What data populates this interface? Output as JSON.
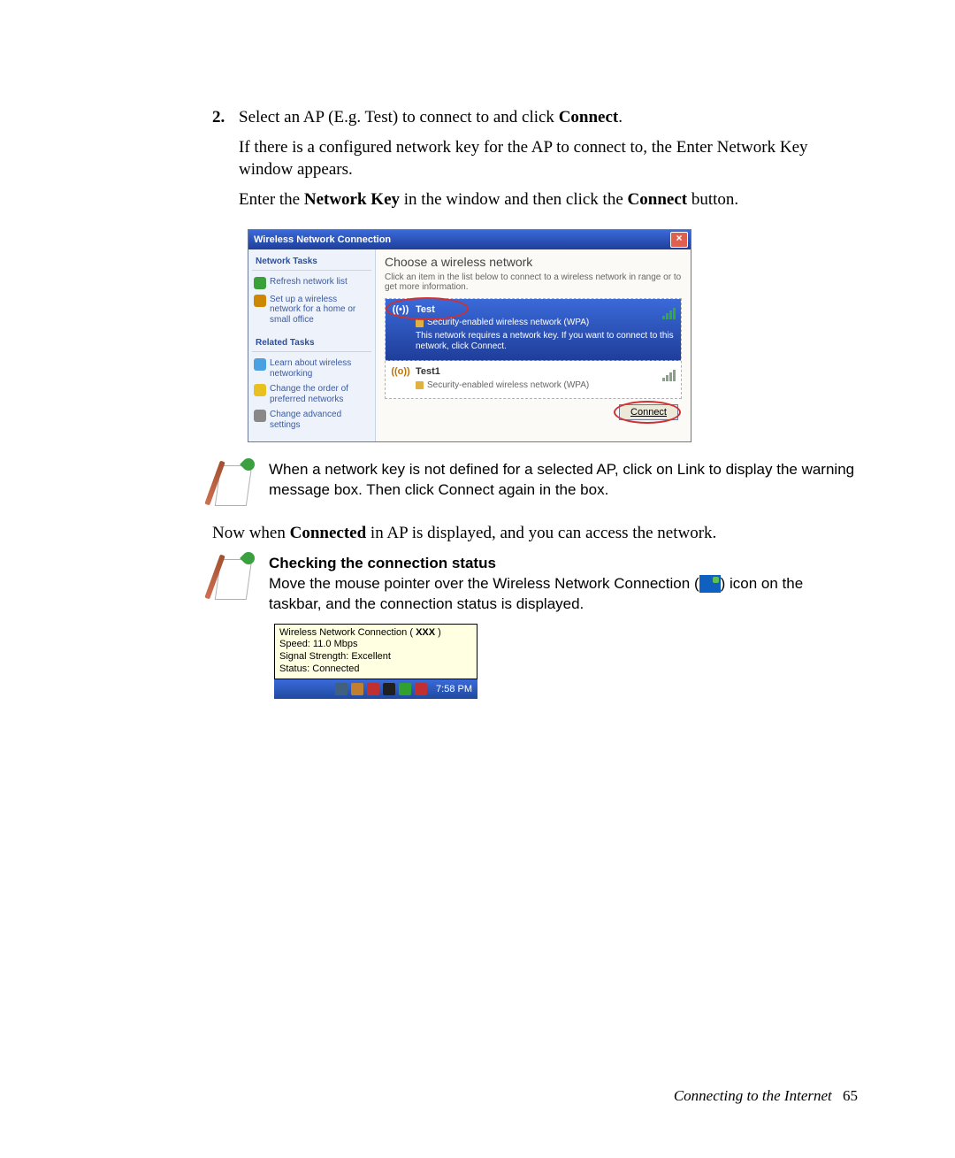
{
  "step": {
    "number": "2.",
    "line1_a": "Select an AP (E.g. Test) to connect to and click ",
    "line1_b": "Connect",
    "line1_c": ".",
    "para2": "If there is a configured network key for the AP to connect to, the Enter Network Key window appears.",
    "para3_a": "Enter the ",
    "para3_b": "Network Key",
    "para3_c": " in the window and then click the ",
    "para3_d": "Connect",
    "para3_e": " button."
  },
  "window": {
    "title": "Wireless Network Connection",
    "sidebar": {
      "tasks_header": "Network Tasks",
      "refresh": "Refresh network list",
      "setup": "Set up a wireless network for a home or small office",
      "related_header": "Related Tasks",
      "learn": "Learn about wireless networking",
      "order": "Change the order of preferred networks",
      "advanced": "Change advanced settings"
    },
    "main": {
      "heading": "Choose a wireless network",
      "subheading": "Click an item in the list below to connect to a wireless network in range or to get more information.",
      "item1": {
        "name": "Test",
        "type": "Security-enabled wireless network (WPA)",
        "hint": "This network requires a network key. If you want to connect to this network, click Connect."
      },
      "item2": {
        "name": "Test1",
        "type": "Security-enabled wireless network (WPA)"
      },
      "connect_label": "Connect"
    }
  },
  "note1": "When a network key is not defined for a selected AP, click on Link to display the warning message box. Then click Connect again in the box.",
  "para_connected_a": "Now when ",
  "para_connected_b": "Connected",
  "para_connected_c": " in AP is displayed, and you can access the network.",
  "note2": {
    "heading": "Checking the connection status",
    "text_a": "Move the mouse pointer over the Wireless Network Connection (",
    "text_b": ") icon on the taskbar, and the connection status is displayed."
  },
  "tooltip": {
    "line1_a": "Wireless Network Connection ( ",
    "line1_b": "XXX",
    "line1_c": " )",
    "line2": "Speed: 11.0 Mbps",
    "line3": "Signal Strength: Excellent",
    "line4": "Status: Connected",
    "time": "7:58 PM"
  },
  "footer": {
    "chapter": "Connecting to the Internet",
    "page": "65"
  }
}
